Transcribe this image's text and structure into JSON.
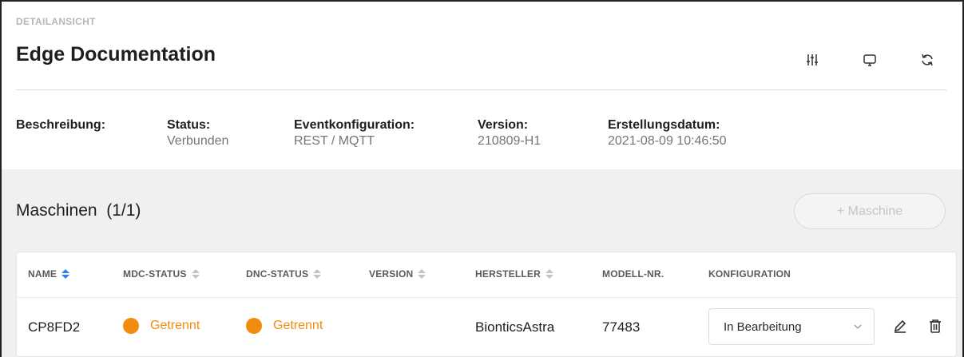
{
  "header": {
    "section_label": "DETAILANSICHT",
    "title": "Edge Documentation",
    "icons": [
      "sliders-icon",
      "monitor-icon",
      "refresh-icon"
    ]
  },
  "info": {
    "beschreibung_label": "Beschreibung:",
    "status_label": "Status:",
    "status_value": "Verbunden",
    "event_label": "Eventkonfiguration:",
    "event_value": "REST / MQTT",
    "version_label": "Version:",
    "version_value": "210809-H1",
    "date_label": "Erstellungsdatum:",
    "date_value": "2021-08-09 10:46:50"
  },
  "machines": {
    "title": "Maschinen",
    "count": "(1/1)",
    "add_button": "+ Maschine",
    "columns": [
      "NAME",
      "MDC-STATUS",
      "DNC-STATUS",
      "VERSION",
      "HERSTELLER",
      "MODELL-NR.",
      "KONFIGURATION"
    ],
    "rows": [
      {
        "name": "CP8FD2",
        "mdc_status": "Getrennt",
        "dnc_status": "Getrennt",
        "version": "",
        "hersteller": "BionticsAstra",
        "modell": "77483",
        "konfiguration": "In Bearbeitung"
      }
    ]
  },
  "colors": {
    "accent": "#2f80ed",
    "status_disconnected": "#f28c0f",
    "muted": "#757575"
  }
}
